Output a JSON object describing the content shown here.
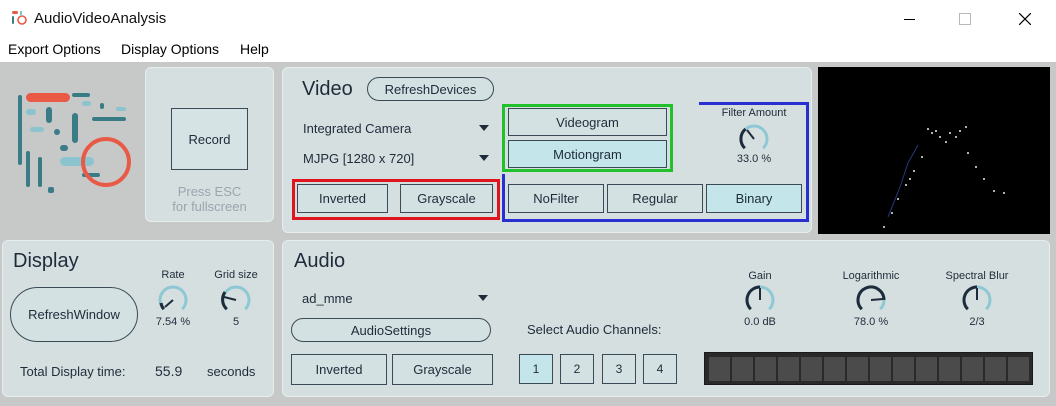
{
  "window": {
    "title": "AudioVideoAnalysis"
  },
  "menu": [
    "Export Options",
    "Display Options",
    "Help"
  ],
  "record": {
    "label": "Record",
    "hint_line1": "Press ESC",
    "hint_line2": "for fullscreen"
  },
  "video": {
    "title": "Video",
    "refresh_label": "RefreshDevices",
    "camera": "Integrated Camera",
    "format": "MJPG [1280 x 720]",
    "inverted_label": "Inverted",
    "grayscale_label": "Grayscale",
    "videogram_label": "Videogram",
    "motiongram_label": "Motiongram",
    "filters": [
      "NoFilter",
      "Regular",
      "Binary"
    ],
    "active_filter": "Binary",
    "filter_amount_label": "Filter Amount",
    "filter_amount_value": "33.0 %",
    "filter_amount_fraction": 0.33
  },
  "display": {
    "title": "Display",
    "refresh_label": "RefreshWindow",
    "rate_label": "Rate",
    "rate_value": "7.54 %",
    "rate_fraction": 0.0754,
    "grid_label": "Grid size",
    "grid_value": "5",
    "total_label": "Total Display time:",
    "total_value": "55.9",
    "total_unit": "seconds"
  },
  "audio": {
    "title": "Audio",
    "device": "ad_mme",
    "settings_label": "AudioSettings",
    "inverted_label": "Inverted",
    "grayscale_label": "Grayscale",
    "channels_label": "Select Audio Channels:",
    "channels": [
      "1",
      "2",
      "3",
      "4"
    ],
    "active_channel": "1",
    "gain_label": "Gain",
    "gain_value": "0.0 dB",
    "log_label": "Logarithmic",
    "log_value": "78.0 %",
    "log_fraction": 0.78,
    "blur_label": "Spectral Blur",
    "blur_value": "2/3"
  },
  "colors": {
    "accent_dark": "#1e2b3a",
    "button_on": "#c4e6ea",
    "highlight_red": "#e0141e",
    "highlight_green": "#22c02a",
    "highlight_blue": "#2a2fd0"
  }
}
